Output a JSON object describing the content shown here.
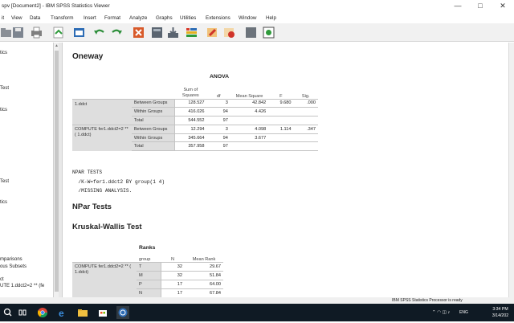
{
  "window": {
    "title": "spv [Document2] - IBM SPSS Statistics Viewer",
    "minimize_glyph": "—",
    "maximize_glyph": "□",
    "close_glyph": "✕"
  },
  "menu": [
    {
      "label": "it"
    },
    {
      "label": "View"
    },
    {
      "label": "Data"
    },
    {
      "label": "Transform"
    },
    {
      "label": "Insert"
    },
    {
      "label": "Format"
    },
    {
      "label": "Analyze"
    },
    {
      "label": "Graphs"
    },
    {
      "label": "Utilities"
    },
    {
      "label": "Extensions"
    },
    {
      "label": "Window"
    },
    {
      "label": "Help"
    }
  ],
  "toolbar_icons": [
    "open-folder-icon",
    "save-icon",
    "print-icon",
    "export-icon",
    "recall-dialog-icon",
    "undo-icon",
    "redo-icon",
    "goto-case-icon",
    "goto-variable-icon",
    "variables-icon",
    "output-icon",
    "designate-window-icon",
    "insert-syntax-icon",
    "previous-icon",
    "next-icon",
    "run-icon"
  ],
  "navigator": {
    "items": [
      {
        "label": "tics"
      },
      {
        "label": "Test"
      },
      {
        "label": "tics"
      },
      {
        "label": "Test"
      },
      {
        "label": "tics"
      },
      {
        "label": "mparisons"
      },
      {
        "label": "ous Subsets"
      },
      {
        "label": "ct"
      },
      {
        "label": "UTE    1.ddct2=2 ** (fe"
      }
    ]
  },
  "output": {
    "oneway_heading": "Oneway",
    "anova": {
      "title": "ANOVA",
      "headers": {
        "sum_squares": "Sum of Squares",
        "df": "df",
        "mean_square": "Mean Square",
        "f": "F",
        "sig": "Sig."
      },
      "groups": [
        {
          "label": "1.ddct",
          "rows": [
            {
              "source": "Between Groups",
              "ss": "128.527",
              "df": "3",
              "ms": "42.842",
              "f": "9.680",
              "sig": ".000"
            },
            {
              "source": "Within Groups",
              "ss": "416.026",
              "df": "94",
              "ms": "4.426",
              "f": "",
              "sig": ""
            },
            {
              "source": "Total",
              "ss": "544.552",
              "df": "97",
              "ms": "",
              "f": "",
              "sig": ""
            }
          ]
        },
        {
          "label": "COMPUTE fer1.ddct2=2 ** (    1.ddct)",
          "rows": [
            {
              "source": "Between Groups",
              "ss": "12.294",
              "df": "3",
              "ms": "4.098",
              "f": "1.114",
              "sig": ".347"
            },
            {
              "source": "Within Groups",
              "ss": "345.664",
              "df": "94",
              "ms": "3.677",
              "f": "",
              "sig": ""
            },
            {
              "source": "Total",
              "ss": "357.958",
              "df": "97",
              "ms": "",
              "f": "",
              "sig": ""
            }
          ]
        }
      ]
    },
    "syntax": [
      "NPAR TESTS",
      "  /K-W=fer1.ddct2 BY group(1 4)",
      "  /MISSING ANALYSIS."
    ],
    "npar_heading": "NPar Tests",
    "kw_heading": "Kruskal-Wallis Test",
    "ranks": {
      "title": "Ranks",
      "headers": {
        "group": "group",
        "n": "N",
        "mean_rank": "Mean Rank"
      },
      "label": "COMPUTE fer1.ddct2=2 ** (    1.ddct)",
      "rows": [
        {
          "group": "T",
          "n": "32",
          "mean_rank": "29.67"
        },
        {
          "group": "M",
          "n": "32",
          "mean_rank": "51.84"
        },
        {
          "group": "P",
          "n": "17",
          "mean_rank": "64.00"
        },
        {
          "group": "N",
          "n": "17",
          "mean_rank": "67.84"
        }
      ]
    }
  },
  "status": {
    "text": "IBM SPSS Statistics Processor is ready"
  },
  "taskbar": {
    "icons": [
      "search-icon",
      "task-view-icon",
      "chrome-icon",
      "edge-icon",
      "file-explorer-icon",
      "store-icon",
      "spss-icon"
    ],
    "tray_text": "ENG",
    "time": "3:34 PM",
    "date": "3/14/202"
  }
}
